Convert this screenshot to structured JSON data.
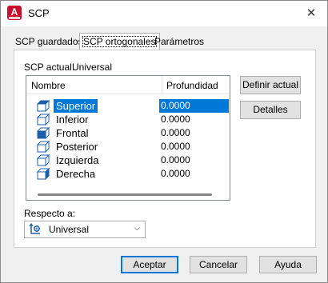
{
  "window": {
    "title": "SCP",
    "close_glyph": "✕"
  },
  "tabs": [
    {
      "label": "SCP guardados",
      "active": false
    },
    {
      "label": "SCP ortogonales",
      "active": true
    },
    {
      "label": "Parámetros",
      "active": false
    }
  ],
  "current": {
    "label": "SCP actual:",
    "value": "Universal"
  },
  "list": {
    "columns": {
      "name": "Nombre",
      "depth": "Profundidad"
    },
    "rows": [
      {
        "name": "Superior",
        "depth": "0.0000",
        "icon": "ucs-top-icon",
        "selected": true
      },
      {
        "name": "Inferior",
        "depth": "0.0000",
        "icon": "ucs-bottom-icon",
        "selected": false
      },
      {
        "name": "Frontal",
        "depth": "0.0000",
        "icon": "ucs-front-icon",
        "selected": false
      },
      {
        "name": "Posterior",
        "depth": "0.0000",
        "icon": "ucs-back-icon",
        "selected": false
      },
      {
        "name": "Izquierda",
        "depth": "0.0000",
        "icon": "ucs-left-icon",
        "selected": false
      },
      {
        "name": "Derecha",
        "depth": "0.0000",
        "icon": "ucs-right-icon",
        "selected": false
      }
    ]
  },
  "buttons": {
    "define_current": "Definir actual",
    "details": "Detalles"
  },
  "relative": {
    "label": "Respecto a:",
    "value": "Universal",
    "icon": "world-ucs-icon"
  },
  "footer": {
    "ok": "Aceptar",
    "cancel": "Cancelar",
    "help": "Ayuda"
  },
  "colors": {
    "accent": "#0078d7",
    "app_icon": "#c8102e"
  }
}
